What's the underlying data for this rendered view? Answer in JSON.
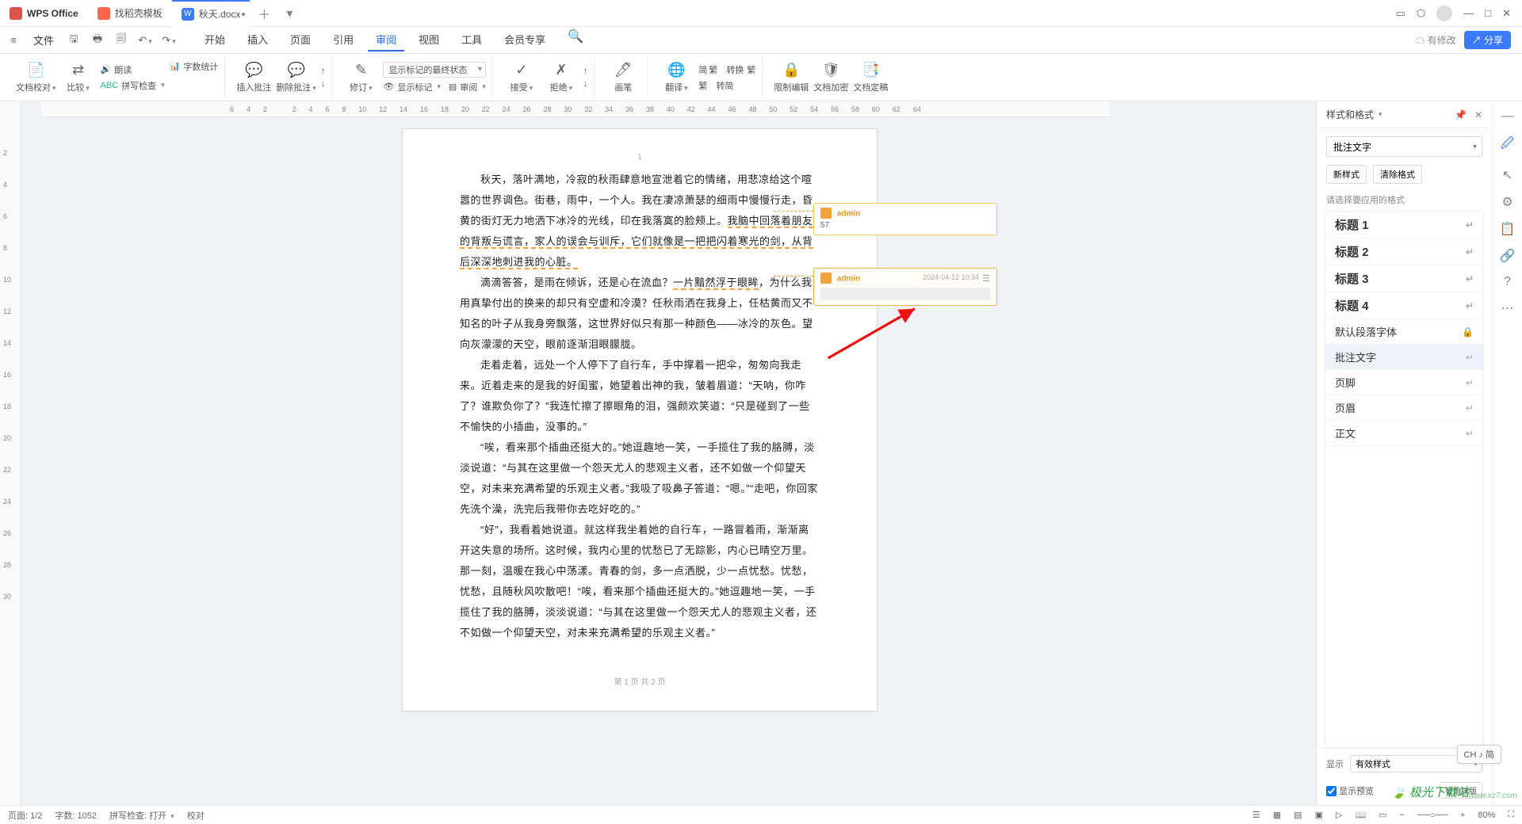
{
  "titlebar": {
    "app": "WPS Office",
    "tab_templates": "找稻壳模板",
    "tab_doc": "秋天.docx",
    "add": "＋",
    "dropdown": "▾",
    "win": {
      "a": "▭",
      "b": "⬡",
      "c": "—",
      "d": "□",
      "e": "✕"
    }
  },
  "menubar": {
    "file": "文件",
    "items": [
      "开始",
      "插入",
      "页面",
      "引用",
      "审阅",
      "视图",
      "工具",
      "会员专享"
    ],
    "active_index": 4,
    "modify": "有修改",
    "share": "分享"
  },
  "ribbon": {
    "g1": {
      "proof": "文档校对",
      "compare": "比较",
      "read": "朗读",
      "abc": "拼写检查",
      "wordcount": "字数统计"
    },
    "g2": {
      "insert": "插入批注",
      "delete": "删除批注"
    },
    "g3": {
      "revise": "修订",
      "combo": "显示标记的最终状态",
      "showmark": "显示标记",
      "review": "审阅"
    },
    "g4": {
      "accept": "接受",
      "reject": "拒绝"
    },
    "g5": {
      "pen": "画笔"
    },
    "g6": {
      "translate": "翻译",
      "convert": "转换",
      "simpl": "转简",
      "trad": "繁"
    },
    "g7": {
      "restrict": "限制编辑",
      "encrypt": "文档加密",
      "finalize": "文档定稿"
    }
  },
  "ruler": [
    "6",
    "4",
    "2",
    "",
    "2",
    "4",
    "6",
    "8",
    "10",
    "12",
    "14",
    "16",
    "18",
    "20",
    "22",
    "24",
    "26",
    "28",
    "30",
    "32",
    "34",
    "36",
    "38",
    "40",
    "42",
    "44",
    "46",
    "48",
    "50",
    "52",
    "54",
    "56",
    "58",
    "60",
    "62",
    "64"
  ],
  "vruler": [
    "2",
    "4",
    "6",
    "8",
    "10",
    "12",
    "14",
    "16",
    "18",
    "20",
    "22",
    "24",
    "26",
    "28",
    "30"
  ],
  "page": {
    "num": "1",
    "p1a": "秋天，落叶满地，冷寂的秋雨肆意地宣泄着它的情绪，用悲凉给这个喧嚣的世界调色。街巷，雨中，一个人。我在凄凉萧瑟的细雨中慢慢行走，昏黄的街灯无力地洒下冰冷的光线，印在我落寞的脸颊上。",
    "p1b": "我脑中回落着朋友的背叛与谎言，家人的误会与训斥，它们就像是一把把闪着寒光的剑，从背后深深地刺进我的心脏。",
    "p2a": "滴滴答答，是雨在倾诉，还是心在流血？",
    "p2b": "一片黯然浮于眼眸",
    "p2c": "，为什么我用真挚付出的换来的却只有空虚和冷漠？任秋雨洒在我身上，任枯黄而又不知名的叶子从我身旁飘落，这世界好似只有那一种颜色——冰冷的灰色。望向灰濛濛的天空，眼前逐渐泪眼朦胧。",
    "p3": "走着走着，远处一个人停下了自行车，手中撑着一把伞，匆匆向我走来。近着走来的是我的好闺蜜，她望着出神的我，皱着眉道：“天呐，你咋了？谁欺负你了？”我连忙擦了擦眼角的泪，强颜欢笑道：“只是碰到了一些不愉快的小插曲，没事的。”",
    "p4": "“唉，看来那个插曲还挺大的。”她逗趣地一笑，一手揽住了我的胳膊，淡淡说道：“与其在这里做一个怨天尤人的悲观主义者，还不如做一个仰望天空，对未来充满希望的乐观主义者。”我吸了吸鼻子答道：“嗯。”“走吧，你回家先洗个澡，洗完后我带你去吃好吃的。”",
    "p5": "“好”，我看着她说道。就这样我坐着她的自行车，一路冒着雨，渐渐离开这失意的场所。这时候，我内心里的忧愁已了无踪影，内心已晴空万里。那一刻，温暖在我心中荡漾。青春的剑，多一点洒脱，少一点忧愁。忧愁，忧愁，且随秋风吹散吧！“唉，看来那个插曲还挺大的。”她逗趣地一笑，一手揽住了我的胳膊，淡淡说道：“与其在这里做一个怨天尤人的悲观主义者，还不如做一个仰望天空，对未来充满希望的乐观主义者。”",
    "footer": "第 1 页 共 2 页"
  },
  "comments": {
    "c1": {
      "author": "admin",
      "body": "57"
    },
    "c2": {
      "author": "admin",
      "time": "2024-04-12 10:34"
    }
  },
  "rightpanel": {
    "title": "样式和格式",
    "combo": "批注文字",
    "new": "新样式",
    "clear": "清除格式",
    "label": "请选择要应用的格式",
    "items": [
      {
        "t": "标题 1",
        "b": true
      },
      {
        "t": "标题 2",
        "b": true
      },
      {
        "t": "标题 3",
        "b": true
      },
      {
        "t": "标题 4",
        "b": true
      },
      {
        "t": "默认段落字体",
        "lock": true
      },
      {
        "t": "批注文字",
        "sel": true
      },
      {
        "t": "页脚"
      },
      {
        "t": "页眉"
      },
      {
        "t": "正文"
      }
    ],
    "show": "显示",
    "show_val": "有效样式",
    "preview": "显示预览",
    "smart": "智能排版"
  },
  "statusbar": {
    "page": "页面: 1/2",
    "words": "字数: 1052",
    "spell": "拼写检查: 打开",
    "proof": "校对",
    "zoom": "80%"
  },
  "ime": "CH ♪ 简",
  "watermark": "极光下载站",
  "watermark_sub": "www.xz7.com"
}
